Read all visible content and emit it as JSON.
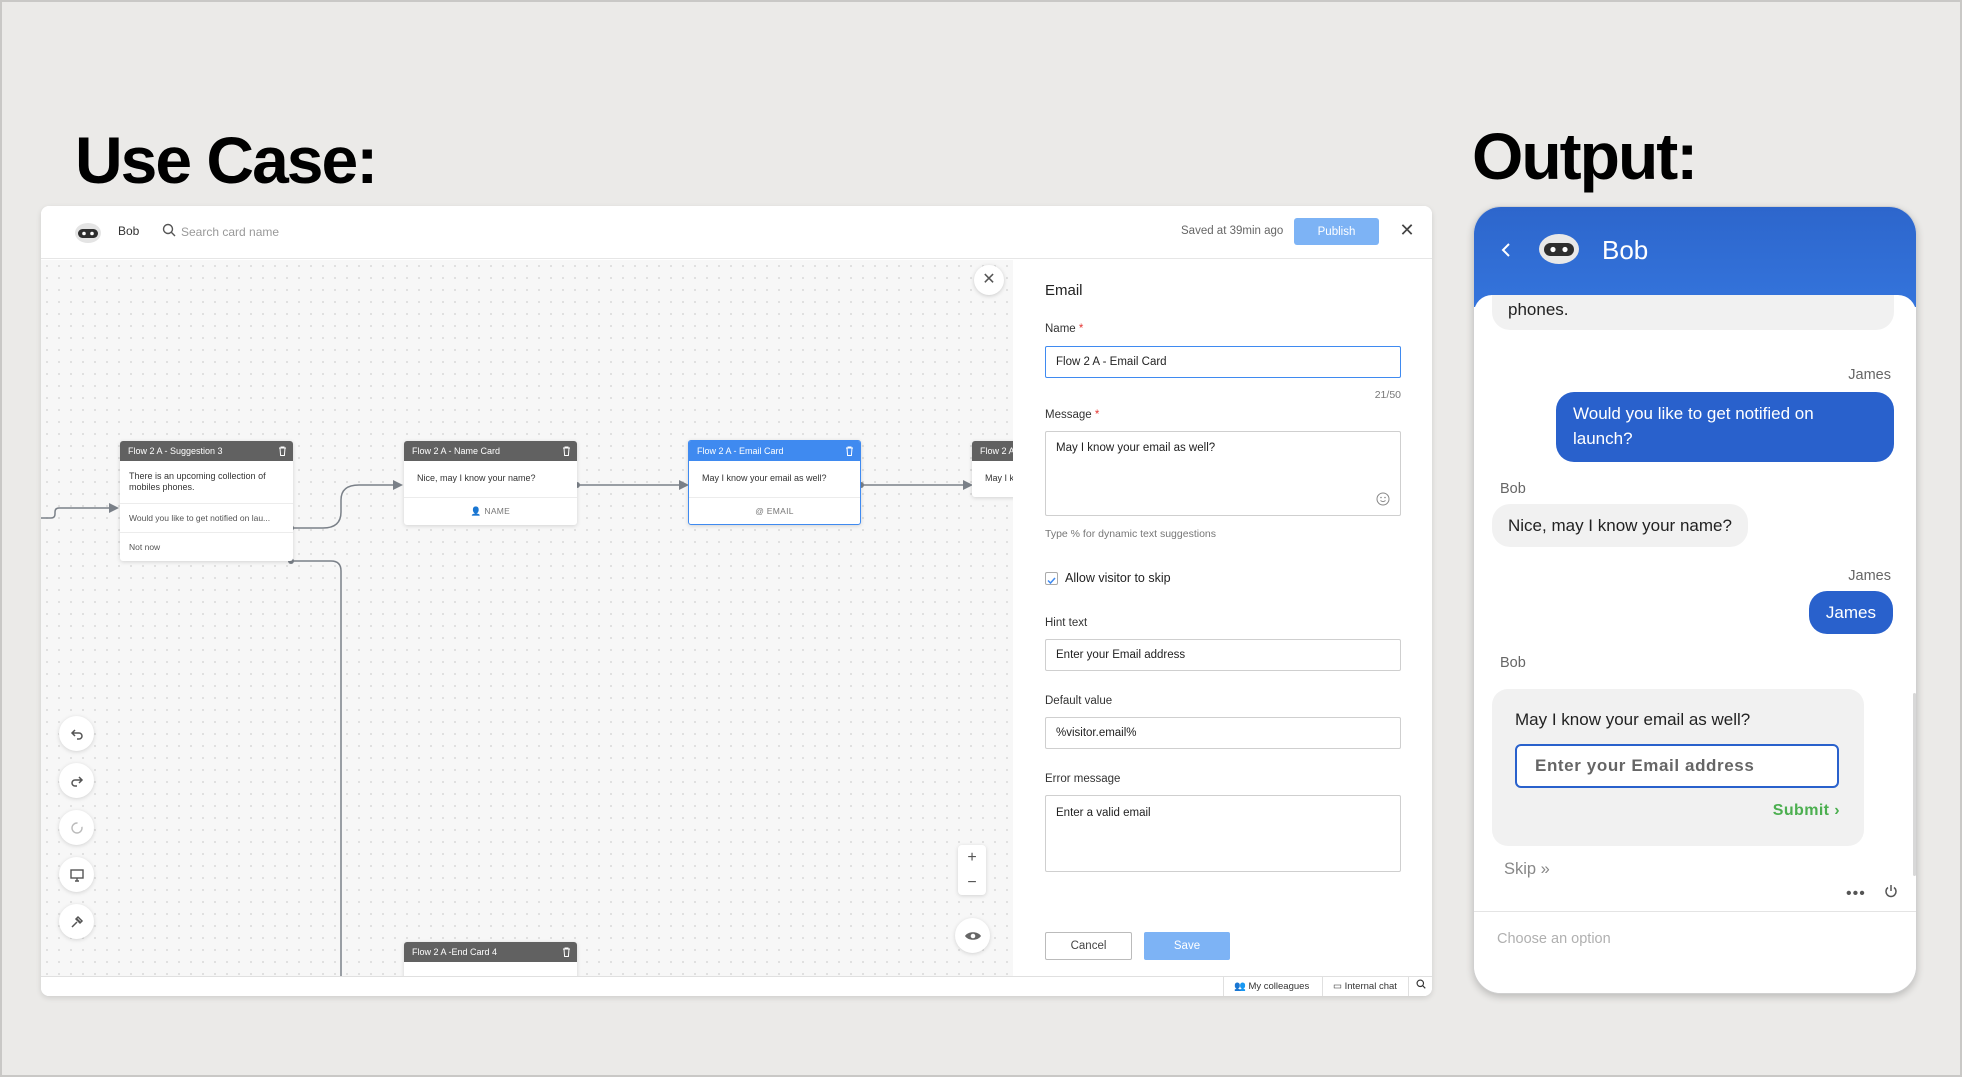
{
  "headings": {
    "use_case": "Use Case:",
    "output": "Output:"
  },
  "builder": {
    "bot_name": "Bob",
    "search_placeholder": "Search card name",
    "saved_text": "Saved at 39min ago",
    "publish_label": "Publish",
    "cards": [
      {
        "title": "Flow 2 A - Suggestion 3",
        "body": "There is an upcoming collection of mobiles phones.",
        "rows": [
          "Would you like to get notified on lau...",
          "Not now"
        ]
      },
      {
        "title": "Flow 2 A - Name Card",
        "body": "Nice, may I know your name?",
        "footer": "NAME",
        "footer_icon": "person-icon"
      },
      {
        "title": "Flow 2 A - Email Card",
        "body": "May I know your email as well?",
        "footer": "EMAIL",
        "footer_icon": "at-icon"
      },
      {
        "title": "Flow 2 A",
        "body": "May I k"
      },
      {
        "title": "Flow 2 A -End Card 4"
      }
    ],
    "tools": [
      "undo-icon",
      "redo-icon",
      "refresh-icon",
      "monitor-icon",
      "pin-icon"
    ],
    "panel": {
      "title": "Email",
      "name_label": "Name",
      "name_value": "Flow 2 A - Email Card",
      "name_counter": "21/50",
      "message_label": "Message",
      "message_value": "May I know your email as well?",
      "message_hint": "Type % for dynamic text suggestions",
      "skip_label": "Allow visitor to skip",
      "hint_label": "Hint text",
      "hint_value": "Enter your Email address",
      "default_label": "Default value",
      "default_value": "%visitor.email%",
      "error_label": "Error message",
      "error_value": "Enter a valid email",
      "cancel_label": "Cancel",
      "save_label": "Save"
    },
    "status": {
      "colleagues": "My colleagues",
      "internal_chat": "Internal chat"
    }
  },
  "chat": {
    "title": "Bob",
    "messages": {
      "bot_1": "phones.",
      "user_1_sender": "James",
      "user_1": "Would you like to get notified on launch?",
      "bot_2_sender": "Bob",
      "bot_2": "Nice, may I know your name?",
      "user_2_sender": "James",
      "user_2": "James",
      "bot_3_sender": "Bob"
    },
    "email_card": {
      "question": "May I know your email as well?",
      "placeholder": "Enter your Email address",
      "submit": "Submit ›"
    },
    "skip": "Skip »",
    "dots": "•••",
    "footer_placeholder": "Choose an option",
    "colors": {
      "header": "#2d66cc",
      "user_bubble": "#2961cc",
      "submit": "#4caf50"
    }
  }
}
